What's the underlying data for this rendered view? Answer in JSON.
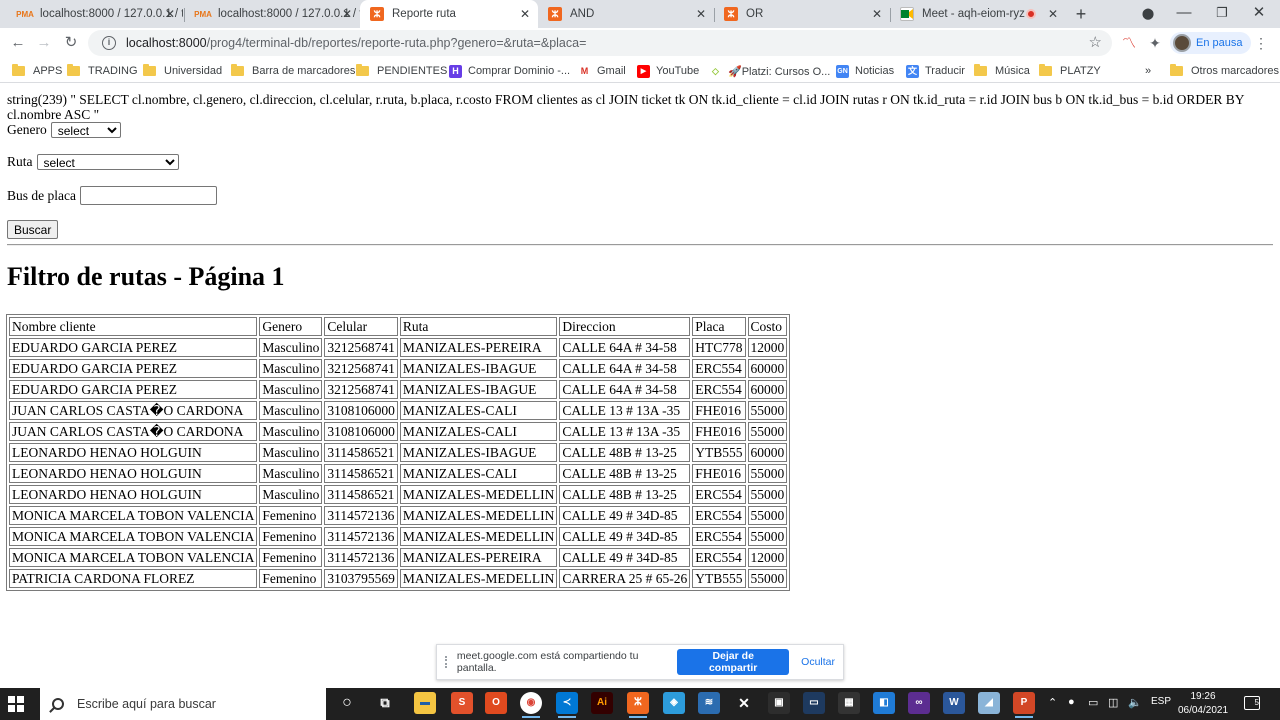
{
  "browser": {
    "tabs": [
      {
        "title": "localhost:8000 / 127.0.0.1 / t",
        "favicon": "phpmyadmin-icon"
      },
      {
        "title": "localhost:8000 / 127.0.0.1 / t",
        "favicon": "phpmyadmin-icon"
      },
      {
        "title": "Reporte ruta",
        "favicon": "xampp-icon"
      },
      {
        "title": "AND",
        "favicon": "xampp-icon"
      },
      {
        "title": "OR",
        "favicon": "xampp-icon"
      },
      {
        "title": "Meet - aqh-eiom-ryz",
        "favicon": "google-meet-icon"
      }
    ],
    "active_tab": 2,
    "url_host": "localhost:8000",
    "url_path": "/prog4/terminal-db/reportes/reporte-ruta.php?genero=&ruta=&placa=",
    "profile_status": "En pausa",
    "bookmarks": [
      {
        "label": "APPS",
        "icon": "folder-icon"
      },
      {
        "label": "TRADING",
        "icon": "folder-icon"
      },
      {
        "label": "Universidad",
        "icon": "folder-icon"
      },
      {
        "label": "Barra de marcadores",
        "icon": "folder-icon"
      },
      {
        "label": "PENDIENTES",
        "icon": "folder-icon"
      },
      {
        "label": "Comprar Dominio -...",
        "icon": "hostinger-icon"
      },
      {
        "label": "Gmail",
        "icon": "gmail-icon"
      },
      {
        "label": "YouTube",
        "icon": "youtube-icon"
      },
      {
        "label": "🚀Platzi: Cursos O...",
        "icon": "platzi-icon"
      },
      {
        "label": "Noticias",
        "icon": "google-news-icon"
      },
      {
        "label": "Traducir",
        "icon": "google-translate-icon"
      },
      {
        "label": "Música",
        "icon": "folder-icon"
      },
      {
        "label": "PLATZY",
        "icon": "folder-icon"
      }
    ],
    "bookmarks_overflow": "»",
    "other_bookmarks": "Otros marcadores"
  },
  "page": {
    "sql_dump": "string(239) \" SELECT cl.nombre, cl.genero, cl.direccion, cl.celular, r.ruta, b.placa, r.costo FROM clientes as cl JOIN ticket tk ON tk.id_cliente = cl.id JOIN rutas r ON tk.id_ruta = r.id JOIN bus b ON tk.id_bus = b.id ORDER BY cl.nombre ASC \"",
    "filters": {
      "genero_label": "Genero",
      "genero_value": "select",
      "ruta_label": "Ruta",
      "ruta_value": "select",
      "placa_label": "Bus de placa",
      "placa_value": "",
      "submit_label": "Buscar"
    },
    "heading": "Filtro de rutas - Página 1",
    "table": {
      "headers": [
        "Nombre cliente",
        "Genero",
        "Celular",
        "Ruta",
        "Direccion",
        "Placa",
        "Costo"
      ],
      "rows": [
        [
          "EDUARDO GARCIA PEREZ",
          "Masculino",
          "3212568741",
          "MANIZALES-PEREIRA",
          "CALLE 64A # 34-58",
          "HTC778",
          "12000"
        ],
        [
          "EDUARDO GARCIA PEREZ",
          "Masculino",
          "3212568741",
          "MANIZALES-IBAGUE",
          "CALLE 64A # 34-58",
          "ERC554",
          "60000"
        ],
        [
          "EDUARDO GARCIA PEREZ",
          "Masculino",
          "3212568741",
          "MANIZALES-IBAGUE",
          "CALLE 64A # 34-58",
          "ERC554",
          "60000"
        ],
        [
          "JUAN CARLOS CASTA�O CARDONA",
          "Masculino",
          "3108106000",
          "MANIZALES-CALI",
          "CALLE 13 # 13A -35",
          "FHE016",
          "55000"
        ],
        [
          "JUAN CARLOS CASTA�O CARDONA",
          "Masculino",
          "3108106000",
          "MANIZALES-CALI",
          "CALLE 13 # 13A -35",
          "FHE016",
          "55000"
        ],
        [
          "LEONARDO HENAO HOLGUIN",
          "Masculino",
          "3114586521",
          "MANIZALES-IBAGUE",
          "CALLE 48B # 13-25",
          "YTB555",
          "60000"
        ],
        [
          "LEONARDO HENAO HOLGUIN",
          "Masculino",
          "3114586521",
          "MANIZALES-CALI",
          "CALLE 48B # 13-25",
          "FHE016",
          "55000"
        ],
        [
          "LEONARDO HENAO HOLGUIN",
          "Masculino",
          "3114586521",
          "MANIZALES-MEDELLIN",
          "CALLE 48B # 13-25",
          "ERC554",
          "55000"
        ],
        [
          "MONICA MARCELA TOBON VALENCIA",
          "Femenino",
          "3114572136",
          "MANIZALES-MEDELLIN",
          "CALLE 49 # 34D-85",
          "ERC554",
          "55000"
        ],
        [
          "MONICA MARCELA TOBON VALENCIA",
          "Femenino",
          "3114572136",
          "MANIZALES-MEDELLIN",
          "CALLE 49 # 34D-85",
          "ERC554",
          "55000"
        ],
        [
          "MONICA MARCELA TOBON VALENCIA",
          "Femenino",
          "3114572136",
          "MANIZALES-PEREIRA",
          "CALLE 49 # 34D-85",
          "ERC554",
          "12000"
        ],
        [
          "PATRICIA CARDONA FLOREZ",
          "Femenino",
          "3103795569",
          "MANIZALES-MEDELLIN",
          "CARRERA 25 # 65-26",
          "YTB555",
          "55000"
        ]
      ]
    }
  },
  "sharing_bar": {
    "message": "meet.google.com está compartiendo tu pantalla.",
    "stop_label": "Dejar de compartir",
    "hide_label": "Ocultar"
  },
  "taskbar": {
    "search_placeholder": "Escribe aquí para buscar",
    "apps": [
      "cortana-icon",
      "task-view-icon",
      "file-explorer-icon",
      "app-icon",
      "office-icon",
      "chrome-icon",
      "vscode-icon",
      "illustrator-icon",
      "xampp-icon",
      "app-icon",
      "app-icon",
      "xbox-icon",
      "store-icon",
      "app-icon",
      "app-icon",
      "app-icon",
      "visual-studio-icon",
      "word-icon",
      "app-icon",
      "powerpoint-icon"
    ],
    "language": "ESP",
    "time": "19:26",
    "date": "06/04/2021",
    "notification_count": "5",
    "colors": {
      "taskbar_bg": "#202020",
      "accent": "#1a73e8"
    }
  }
}
